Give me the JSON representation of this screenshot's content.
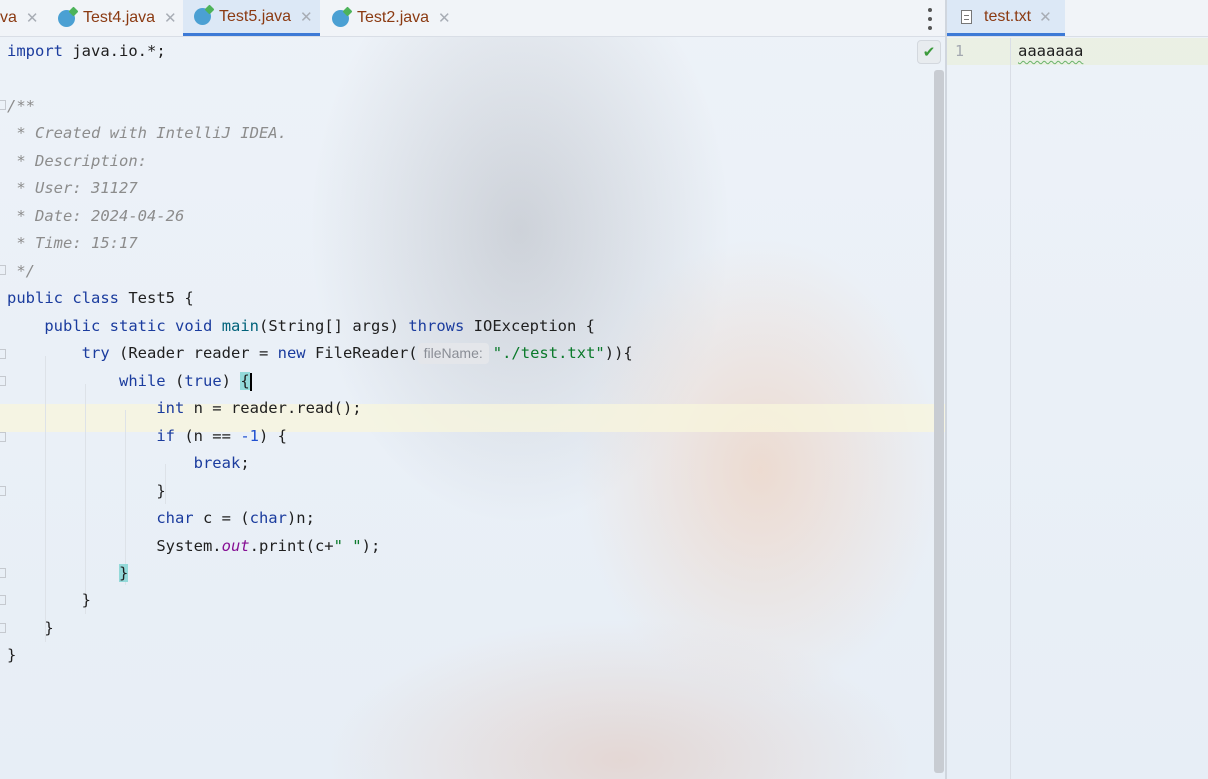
{
  "tabs": [
    {
      "label": "va",
      "active": false
    },
    {
      "label": "Test4.java",
      "active": false
    },
    {
      "label": "Test5.java",
      "active": true
    },
    {
      "label": "Test2.java",
      "active": false
    }
  ],
  "right_panel": {
    "tab_label": "test.txt",
    "line_number": "1",
    "content": "aaaaaaa"
  },
  "code": {
    "l1_import": "import",
    "l1_rest": " java.io.*;",
    "c_open": "/**",
    "c1": " * Created with IntelliJ IDEA.",
    "c2": " * Description:",
    "c3": " * User: 31127",
    "c4": " * Date: 2024-04-26",
    "c5": " * Time: 15:17",
    "c_close": " */",
    "cls_public": "public",
    "cls_class": "class",
    "cls_name": " Test5 {",
    "m_public": "public",
    "m_static": "static",
    "m_void": "void",
    "m_name": "main",
    "m_args": "(String[] args) ",
    "m_throws": "throws",
    "m_exc": " IOException {",
    "try_kw": "try",
    "try_a": " (Reader reader = ",
    "try_new": "new",
    "try_b": " FileReader(",
    "try_hint": "fileName:",
    "try_str": "\"./test.txt\"",
    "try_c": ")){",
    "while_kw": "while",
    "while_a": " (",
    "while_true": "true",
    "while_b": ") ",
    "while_brace": "{",
    "int_kw": "int",
    "int_rest": " n = reader.read();",
    "if_kw": "if",
    "if_a": " (n == ",
    "if_num": "-1",
    "if_b": ") {",
    "break_kw": "break",
    "break_semi": ";",
    "close_if": "}",
    "char_kw": "char",
    "char_a": " c = (",
    "char_kw2": "char",
    "char_b": ")n;",
    "sys_a": "System.",
    "sys_out": "out",
    "sys_b": ".print(c+",
    "sys_str": "\" \"",
    "sys_c": ");",
    "close_while": "}",
    "close_try": "}",
    "close_main": "}",
    "close_class": "}"
  },
  "colors": {
    "keyword": "#1b3c9e",
    "comment": "#8c8c8c",
    "string": "#0b7a2b",
    "tab_text": "#8b3a12",
    "active_tab_underline": "#3d7ad6"
  }
}
